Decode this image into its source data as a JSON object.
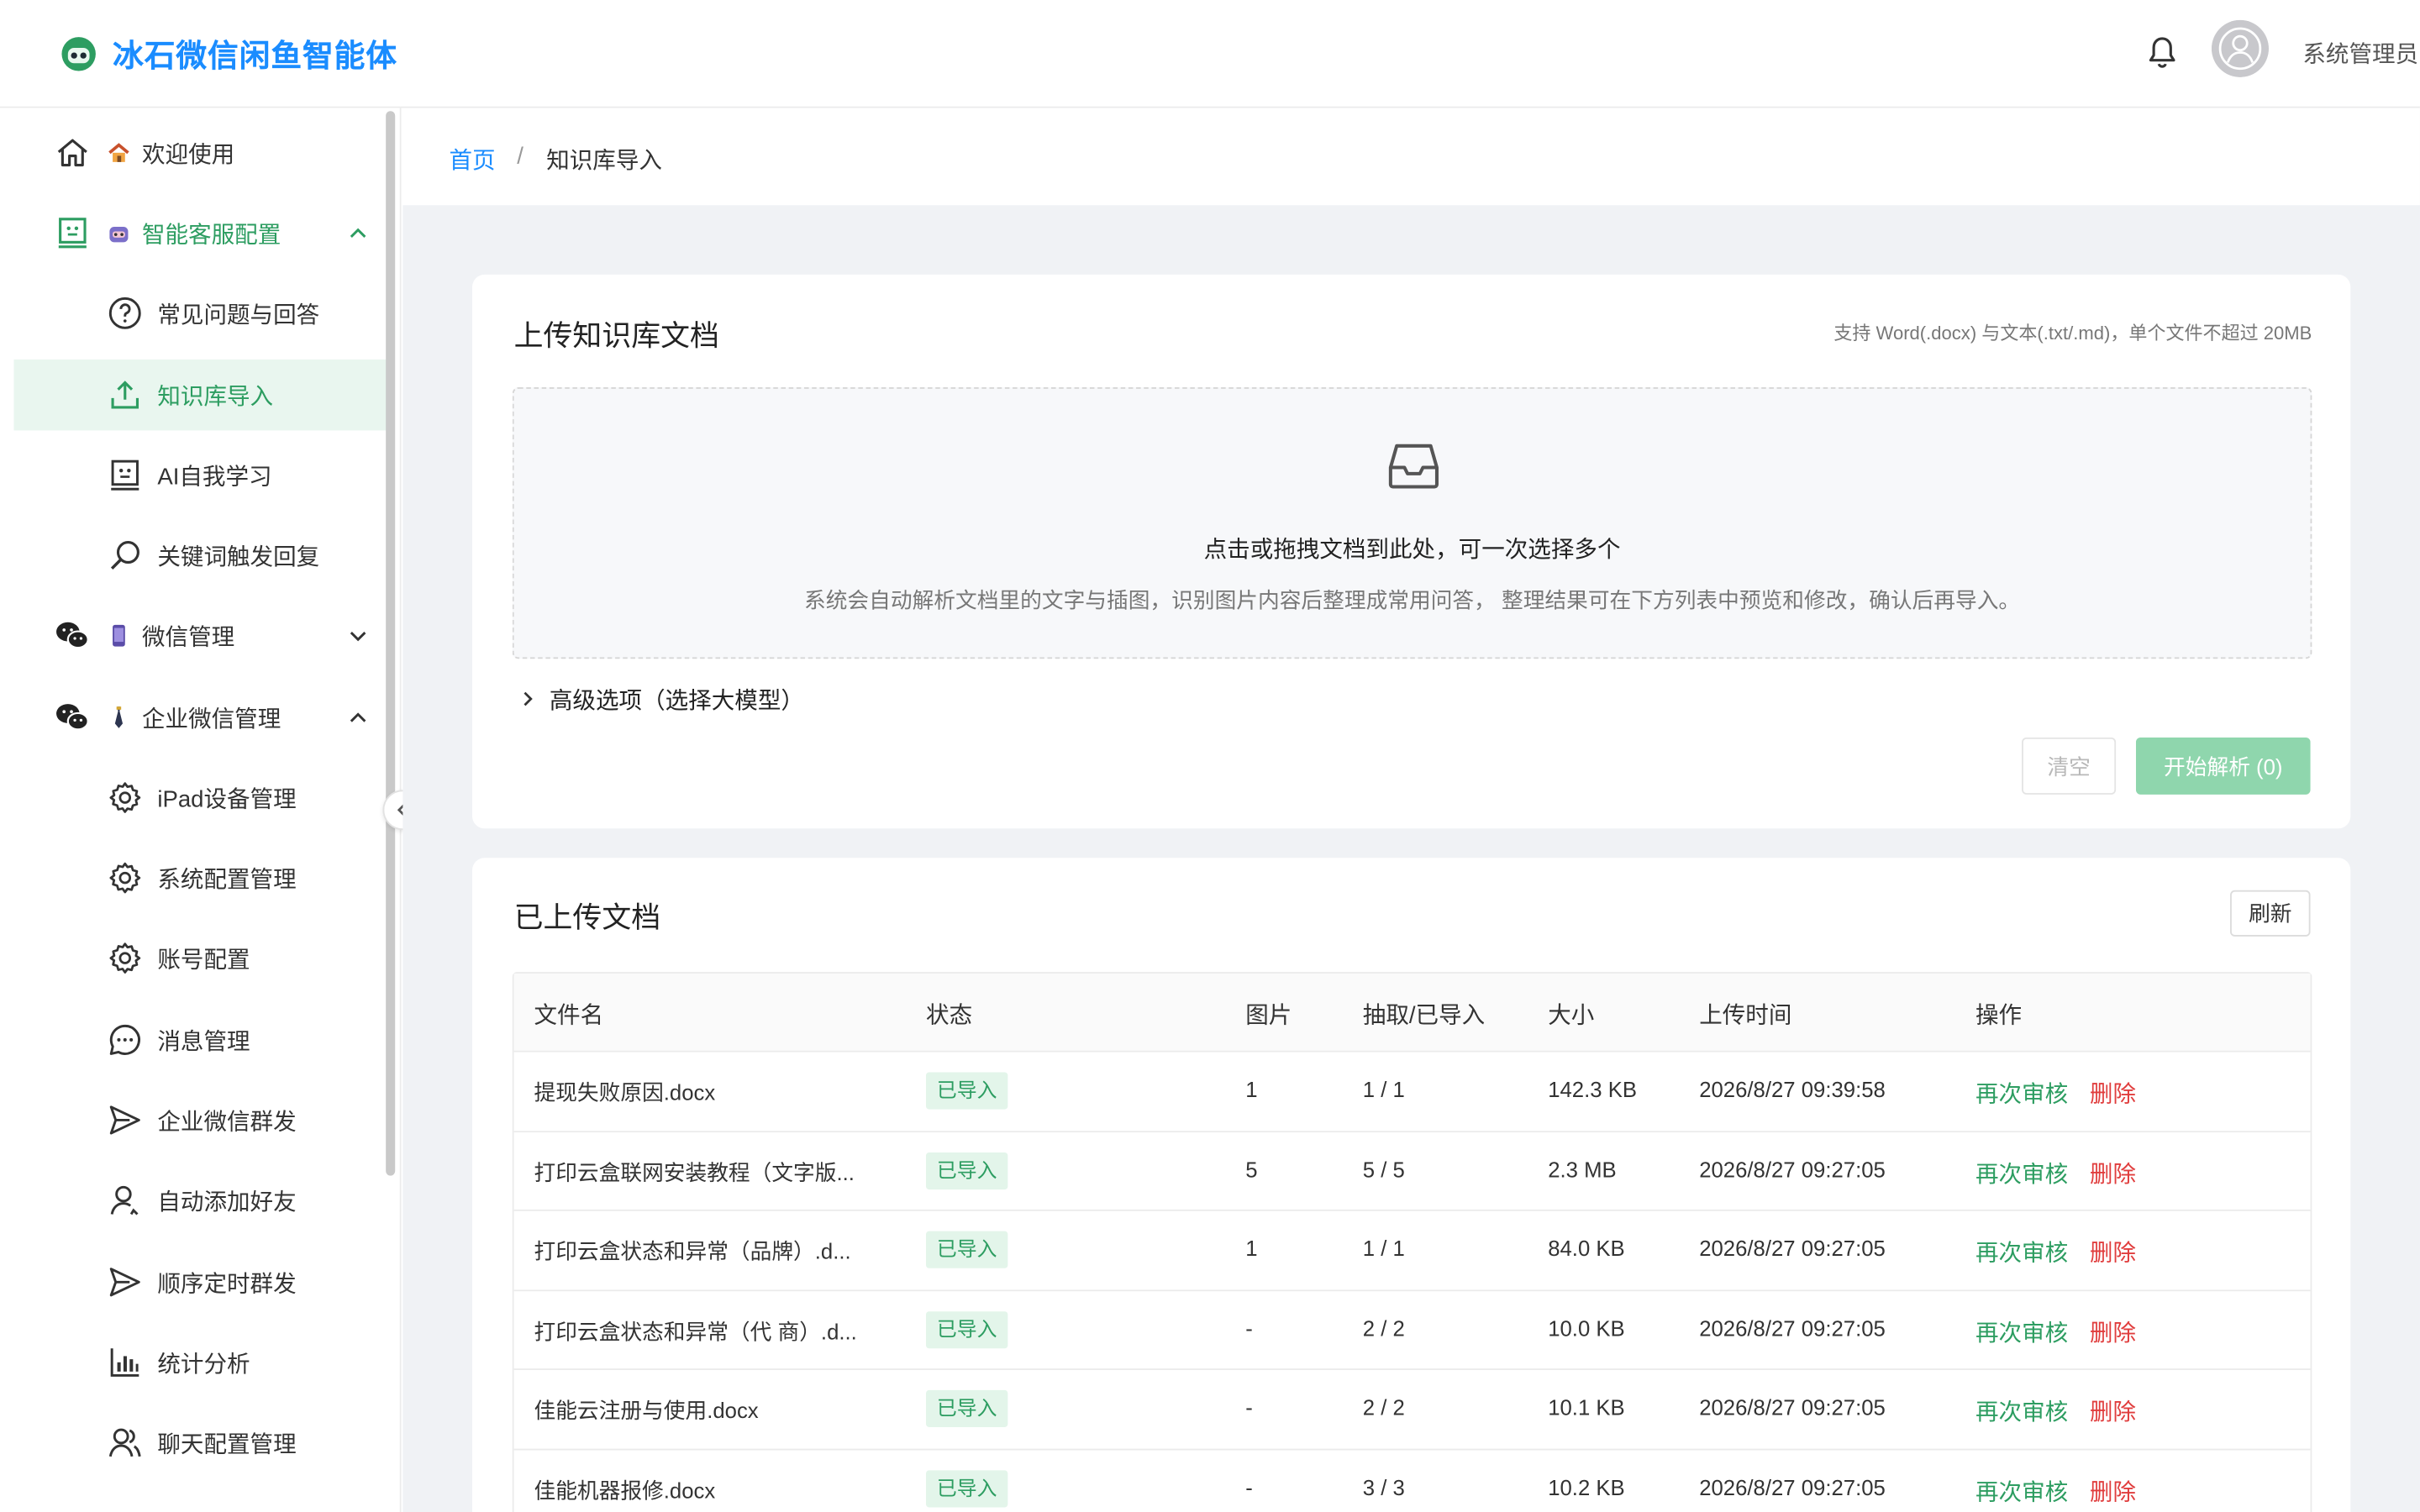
{
  "app": {
    "title": "冰石微信闲鱼智能体",
    "username": "系统管理员"
  },
  "sidebar": {
    "items": [
      {
        "label": "欢迎使用"
      },
      {
        "label": "智能客服配置"
      },
      {
        "label": "常见问题与回答"
      },
      {
        "label": "知识库导入"
      },
      {
        "label": "AI自我学习"
      },
      {
        "label": "关键词触发回复"
      },
      {
        "label": "微信管理"
      },
      {
        "label": "企业微信管理"
      },
      {
        "label": "iPad设备管理"
      },
      {
        "label": "系统配置管理"
      },
      {
        "label": "账号配置"
      },
      {
        "label": "消息管理"
      },
      {
        "label": "企业微信群发"
      },
      {
        "label": "自动添加好友"
      },
      {
        "label": "顺序定时群发"
      },
      {
        "label": "统计分析"
      },
      {
        "label": "聊天配置管理"
      }
    ]
  },
  "breadcrumb": {
    "home": "首页",
    "separator": "/",
    "current": "知识库导入"
  },
  "upload": {
    "title": "上传知识库文档",
    "hint": "支持 Word(.docx) 与文本(.txt/.md)，单个文件不超过 20MB",
    "dropzone_title": "点击或拖拽文档到此处，可一次选择多个",
    "dropzone_desc": "系统会自动解析文档里的文字与插图，识别图片内容后整理成常用问答， 整理结果可在下方列表中预览和修改，确认后再导入。",
    "advanced": "高级选项（选择大模型）",
    "clear": "清空",
    "parse": "开始解析 (0)"
  },
  "uploaded": {
    "title": "已上传文档",
    "refresh": "刷新",
    "columns": [
      "文件名",
      "状态",
      "图片",
      "抽取/已导入",
      "大小",
      "上传时间",
      "操作"
    ],
    "rows": [
      {
        "name": "提现失败原因.docx",
        "status": "已导入",
        "images": "1",
        "extracted": "1 / 1",
        "size": "142.3 KB",
        "time": "2026/8/27 09:39:58",
        "review": "再次审核",
        "delete": "删除"
      },
      {
        "name": "打印云盒联网安装教程（文字版...",
        "status": "已导入",
        "images": "5",
        "extracted": "5 / 5",
        "size": "2.3 MB",
        "time": "2026/8/27 09:27:05",
        "review": "再次审核",
        "delete": "删除"
      },
      {
        "name": "打印云盒状态和异常（品牌）.d...",
        "status": "已导入",
        "images": "1",
        "extracted": "1 / 1",
        "size": "84.0 KB",
        "time": "2026/8/27 09:27:05",
        "review": "再次审核",
        "delete": "删除"
      },
      {
        "name": "打印云盒状态和异常（代 商）.d...",
        "status": "已导入",
        "images": "-",
        "extracted": "2 / 2",
        "size": "10.0 KB",
        "time": "2026/8/27 09:27:05",
        "review": "再次审核",
        "delete": "删除"
      },
      {
        "name": "佳能云注册与使用.docx",
        "status": "已导入",
        "images": "-",
        "extracted": "2 / 2",
        "size": "10.1 KB",
        "time": "2026/8/27 09:27:05",
        "review": "再次审核",
        "delete": "删除"
      },
      {
        "name": "佳能机器报修.docx",
        "status": "已导入",
        "images": "-",
        "extracted": "3 / 3",
        "size": "10.2 KB",
        "time": "2026/8/27 09:27:05",
        "review": "再次审核",
        "delete": "删除"
      }
    ]
  },
  "colors": {
    "brand": "#1a8cff",
    "green": "#2d9d61",
    "danger": "#e03d3d",
    "parse_button": "#8fd6ad"
  }
}
